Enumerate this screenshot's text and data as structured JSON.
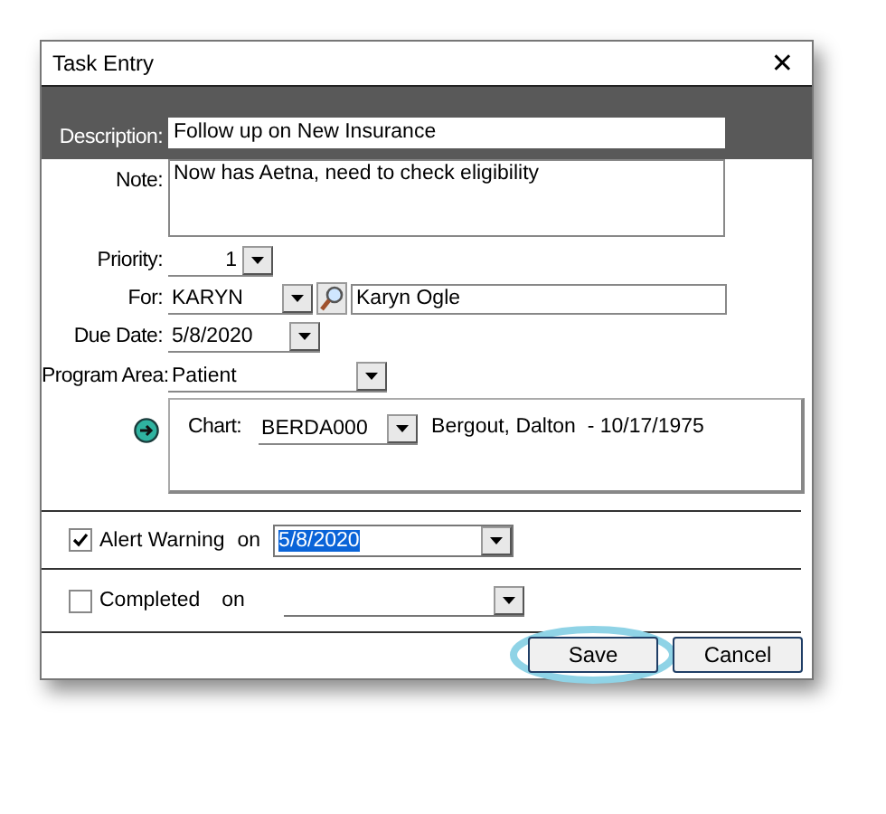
{
  "window": {
    "title": "Task Entry",
    "close": "✕"
  },
  "description": {
    "label": "Description:",
    "value": "Follow up on New Insurance"
  },
  "note": {
    "label": "Note:",
    "value": "Now has Aetna, need to check eligibility"
  },
  "priority": {
    "label": "Priority:",
    "value": "1"
  },
  "for": {
    "label": "For:",
    "value": "KARYN",
    "name": "Karyn Ogle"
  },
  "due_date": {
    "label": "Due Date:",
    "value": "5/8/2020"
  },
  "program_area": {
    "label": "Program Area:",
    "value": "Patient"
  },
  "chart": {
    "label": "Chart:",
    "value": "BERDA000",
    "patient": "Bergout, Dalton  - 10/17/1975"
  },
  "alert": {
    "label": "Alert Warning",
    "on_label": "on",
    "value": "5/8/2020",
    "checked": true,
    "text_selected": true
  },
  "completed": {
    "label": "Completed",
    "on_label": "on",
    "checked": false
  },
  "buttons": [
    {
      "label": "Save",
      "highlighted": true
    },
    {
      "label": "Cancel",
      "highlighted": false
    }
  ]
}
